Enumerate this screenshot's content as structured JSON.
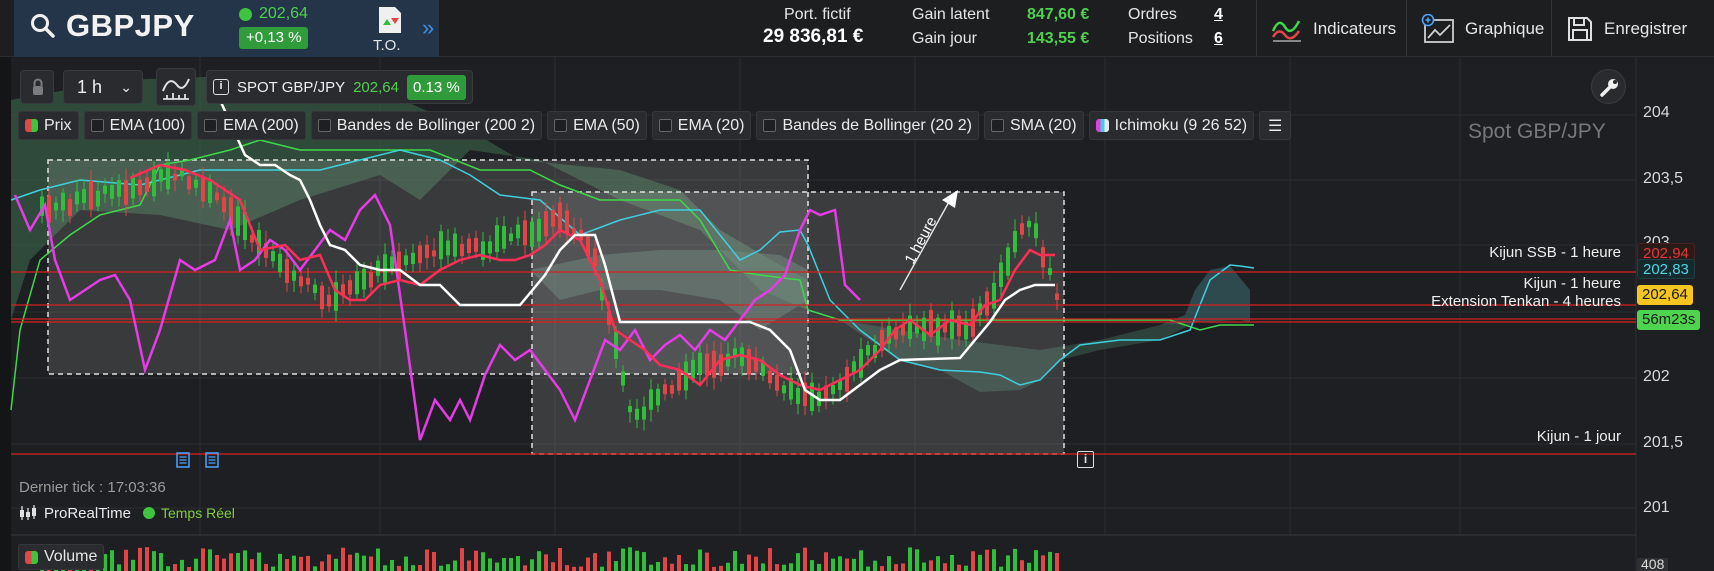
{
  "header": {
    "symbol": "GBPJPY",
    "price": "202,64",
    "change": "+0,13 %",
    "to_label": "T.O.",
    "portfolio_label": "Port. fictif",
    "portfolio_value": "29 836,81 €",
    "gain_latent_label": "Gain latent",
    "gain_latent_value": "847,60 €",
    "gain_jour_label": "Gain jour",
    "gain_jour_value": "143,55 €",
    "orders_label": "Ordres",
    "orders_value": "4",
    "positions_label": "Positions",
    "positions_value": "6",
    "btn_indicateurs": "Indicateurs",
    "btn_graphique": "Graphique",
    "btn_enregistrer": "Enregistrer"
  },
  "toolbar": {
    "timeframe": "1 h",
    "instrument": "SPOT GBP/JPY",
    "instrument_price": "202,64",
    "instrument_change": "0.13 %"
  },
  "legend": [
    {
      "label": "Prix",
      "kind": "prix"
    },
    {
      "label": "EMA (100)",
      "kind": "box"
    },
    {
      "label": "EMA (200)",
      "kind": "box"
    },
    {
      "label": "Bandes de Bollinger (200 2)",
      "kind": "box"
    },
    {
      "label": "EMA (50)",
      "kind": "box"
    },
    {
      "label": "EMA (20)",
      "kind": "box"
    },
    {
      "label": "Bandes de Bollinger (20 2)",
      "kind": "box"
    },
    {
      "label": "SMA (20)",
      "kind": "box"
    },
    {
      "label": "Ichimoku (9 26 52)",
      "kind": "ichi"
    }
  ],
  "chart": {
    "title": "Spot GBP/JPY",
    "y_ticks": [
      "204",
      "203,5",
      "202",
      "201,5",
      "201"
    ],
    "partial_tick": "203",
    "price_tags": {
      "red": "202,94",
      "cyan": "202,83",
      "yellow": "202,64",
      "timer": "56m23s"
    },
    "annotation_arrow": "1 heure",
    "lines": [
      {
        "label": "Kijun SSB - 1 heure"
      },
      {
        "label": "Kijun - 1 heure"
      },
      {
        "label": "Extension Tenkan - 4 heures"
      },
      {
        "label": "Kijun - 1 jour"
      }
    ],
    "colors": {
      "tenkan": "#ff2e55",
      "kijun": "#ffffff",
      "chikou": "#e83be8",
      "ssa": "#3fd84a",
      "ssb": "#3fd0e0",
      "level": "#d82020",
      "bull": "#2fbf3a",
      "bear": "#e24545"
    }
  },
  "footer": {
    "last_tick": "Dernier tick : 17:03:36",
    "brand": "ProRealTime",
    "realtime": "Temps Réel",
    "volume_label": "Volume",
    "volume_tick": "408"
  }
}
